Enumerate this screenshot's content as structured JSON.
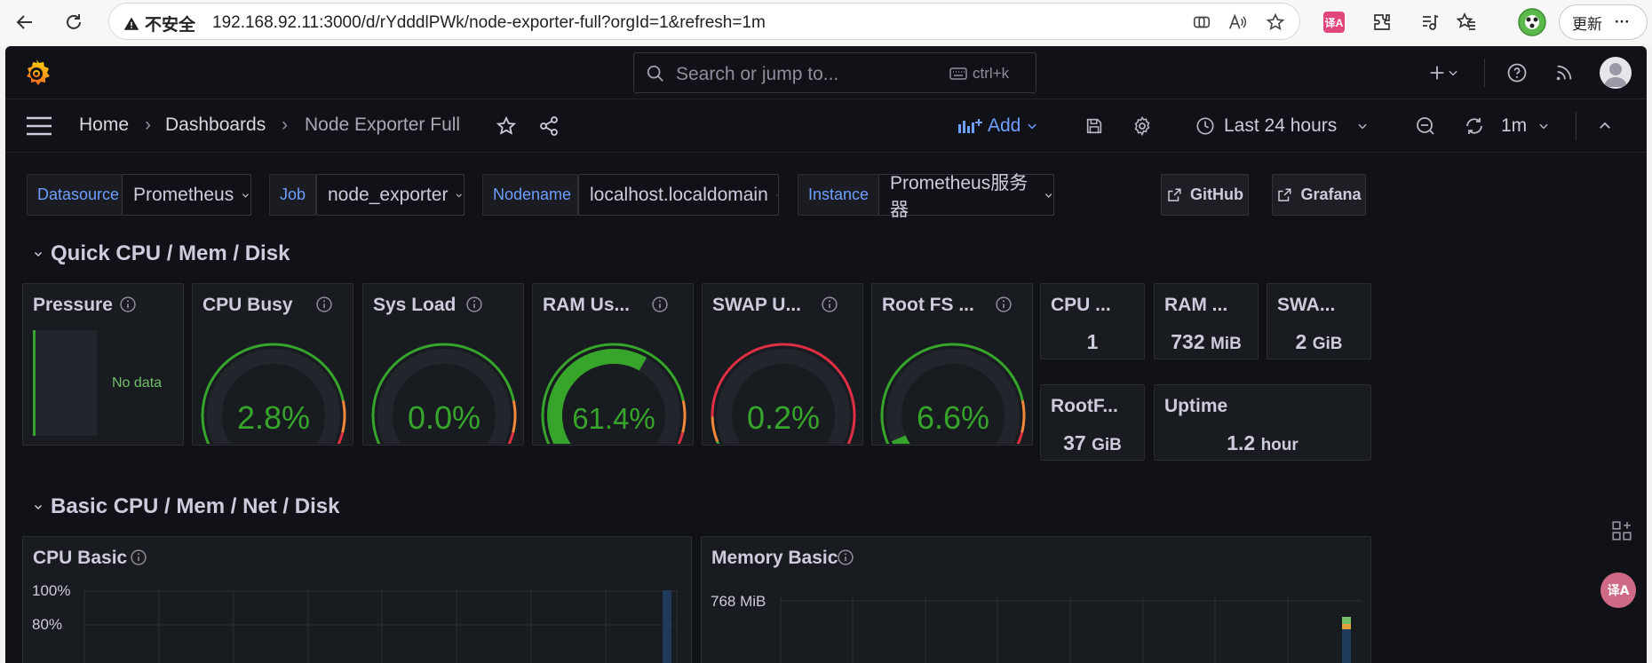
{
  "browser": {
    "security_label": "不安全",
    "url": "192.168.92.11:3000/d/rYdddlPWk/node-exporter-full?orgId=1&refresh=1m",
    "update_label": "更新",
    "more_label": "···"
  },
  "topbar": {
    "search_placeholder": "Search or jump to...",
    "shortcut": "ctrl+k"
  },
  "breadcrumb": {
    "home": "Home",
    "dashboards": "Dashboards",
    "current": "Node Exporter Full",
    "sep": "›"
  },
  "toolbar": {
    "add_label": "Add",
    "time_range": "Last 24 hours",
    "refresh_interval": "1m"
  },
  "variables": [
    {
      "label": "Datasource",
      "value": "Prometheus"
    },
    {
      "label": "Job",
      "value": "node_exporter"
    },
    {
      "label": "Nodename",
      "value": "localhost.localdomain"
    },
    {
      "label": "Instance",
      "value": "Prometheus服务器"
    }
  ],
  "links": {
    "github": "GitHub",
    "grafana": "Grafana"
  },
  "rows": {
    "quick": "Quick CPU / Mem / Disk",
    "basic": "Basic CPU / Mem / Net / Disk"
  },
  "panels": {
    "pressure": {
      "title": "Pressure",
      "no_data": "No data"
    },
    "gauges": [
      {
        "title": "CPU Busy",
        "value": "2.8%",
        "percent": 2.8
      },
      {
        "title": "Sys Load",
        "value": "0.0%",
        "percent": 0.0
      },
      {
        "title": "RAM Us...",
        "value": "61.4%",
        "percent": 61.4
      },
      {
        "title": "SWAP U...",
        "value": "0.2%",
        "percent": 0.2
      },
      {
        "title": "Root FS ...",
        "value": "6.6%",
        "percent": 6.6
      }
    ],
    "stats": {
      "cpu_cores": {
        "title": "CPU ...",
        "value": "1",
        "unit": ""
      },
      "ram_total": {
        "title": "RAM ...",
        "value": "732",
        "unit": "MiB"
      },
      "swap_total": {
        "title": "SWA...",
        "value": "2",
        "unit": "GiB"
      },
      "rootfs_total": {
        "title": "RootF...",
        "value": "37",
        "unit": "GiB"
      },
      "uptime": {
        "title": "Uptime",
        "value": "1.2",
        "unit": "hour"
      }
    },
    "cpu_basic": {
      "title": "CPU Basic",
      "y_labels": [
        "100%",
        "80%"
      ]
    },
    "memory_basic": {
      "title": "Memory Basic",
      "y_labels": [
        "768 MiB"
      ]
    }
  },
  "colors": {
    "green": "#37a52b",
    "orange": "#f2883a",
    "red": "#e02f44",
    "blue": "#6e9fff",
    "background": "#111217",
    "panel": "#181b1f"
  }
}
